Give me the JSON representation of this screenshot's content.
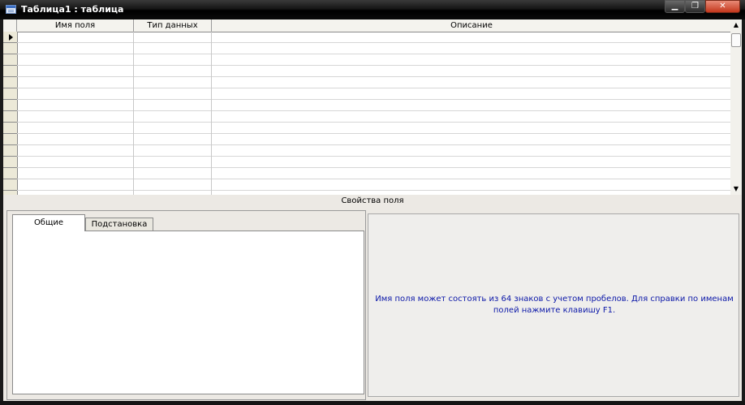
{
  "window": {
    "title": "Таблица1 : таблица",
    "title_icon": "table-icon",
    "controls": {
      "minimize": "▁",
      "maximize": "❐",
      "close": "✕"
    }
  },
  "grid": {
    "columns": [
      "Имя поля",
      "Тип данных",
      "Описание"
    ],
    "row_count": 14,
    "current_row_indicator": "arrow-right-icon"
  },
  "field_properties": {
    "label": "Свойства поля",
    "tabs": [
      {
        "label": "Общие",
        "active": true
      },
      {
        "label": "Подстановка",
        "active": false
      }
    ]
  },
  "help": {
    "line1": "Имя поля может состоять из 64 знаков с учетом пробелов.  Для справки по именам",
    "line2": "полей нажмите клавишу F1."
  },
  "colors": {
    "help_text": "#0b17a8",
    "titlebar": "#000000",
    "close_button": "#c4371c"
  }
}
